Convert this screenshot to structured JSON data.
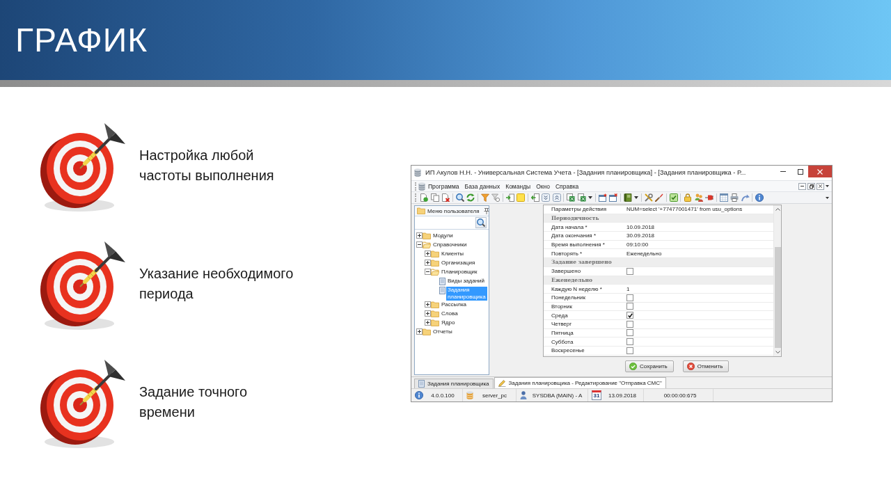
{
  "header": {
    "title": "ГРАФИК"
  },
  "features": [
    {
      "text": "Настройка любой\nчастоты выполнения"
    },
    {
      "text": "Указание необходимого\nпериода"
    },
    {
      "text": "Задание точного\nвремени"
    }
  ],
  "window": {
    "title": "ИП Акулов Н.Н. - Универсальная Система Учета - [Задания планировщика] - [Задания планировщика - Р..."
  },
  "menu": [
    "Программа",
    "База данных",
    "Команды",
    "Окно",
    "Справка"
  ],
  "sidebar": {
    "title": "Меню пользователя",
    "tree": [
      {
        "label": "Модули",
        "kind": "folder",
        "expanded": false,
        "selected": false
      },
      {
        "label": "Справочники",
        "kind": "folder",
        "expanded": true,
        "selected": false,
        "children": [
          {
            "label": "Клиенты",
            "kind": "folder",
            "expanded": false,
            "selected": false
          },
          {
            "label": "Организация",
            "kind": "folder",
            "expanded": false,
            "selected": false
          },
          {
            "label": "Планировщик",
            "kind": "folder",
            "expanded": true,
            "selected": false,
            "children": [
              {
                "label": "Виды заданий",
                "kind": "document",
                "selected": false
              },
              {
                "label": "Задания планировщика",
                "kind": "document",
                "selected": true
              }
            ]
          },
          {
            "label": "Рассылка",
            "kind": "folder",
            "expanded": false,
            "selected": false
          },
          {
            "label": "Слова",
            "kind": "folder",
            "expanded": false,
            "selected": false
          },
          {
            "label": "Ядро",
            "kind": "folder",
            "expanded": false,
            "selected": false
          }
        ]
      },
      {
        "label": "Отчеты",
        "kind": "folder",
        "expanded": false,
        "selected": false
      }
    ]
  },
  "form": {
    "rows": [
      {
        "kind": "text",
        "label": "Параметры действия",
        "value": "NUM=select '+77477001471' from usu_options"
      },
      {
        "kind": "section",
        "label": "Периодичность"
      },
      {
        "kind": "text",
        "label": "Дата начала *",
        "value": "10.09.2018"
      },
      {
        "kind": "text",
        "label": "Дата окончания *",
        "value": "30.09.2018"
      },
      {
        "kind": "text",
        "label": "Время выполнения *",
        "value": "09:10:00"
      },
      {
        "kind": "text",
        "label": "Повторять *",
        "value": "Еженедельно"
      },
      {
        "kind": "section",
        "label": "Задание завершено"
      },
      {
        "kind": "checkbox",
        "label": "Завершено",
        "checked": false
      },
      {
        "kind": "section",
        "label": "Еженедельно"
      },
      {
        "kind": "text",
        "label": "Каждую N неделю *",
        "value": "1"
      },
      {
        "kind": "checkbox",
        "label": "Понедельник",
        "checked": false
      },
      {
        "kind": "checkbox",
        "label": "Вторник",
        "checked": false
      },
      {
        "kind": "checkbox",
        "label": "Среда",
        "checked": true
      },
      {
        "kind": "checkbox",
        "label": "Четверг",
        "checked": false
      },
      {
        "kind": "checkbox",
        "label": "Пятница",
        "checked": false
      },
      {
        "kind": "checkbox",
        "label": "Суббота",
        "checked": false
      },
      {
        "kind": "checkbox",
        "label": "Воскресенье",
        "checked": false
      }
    ]
  },
  "buttons": [
    {
      "kind": "save",
      "label": "Сохранить"
    },
    {
      "kind": "cancel",
      "label": "Отменить"
    }
  ],
  "tabs": [
    {
      "label": "Задания планировщика",
      "kind": "list",
      "selected": false
    },
    {
      "label": "Задания планировщика - Редактирование \"Отправка СМС\"",
      "kind": "edit",
      "selected": true
    }
  ],
  "status_bar": [
    {
      "kind": "version",
      "text": "4.0.0.100"
    },
    {
      "kind": "server",
      "text": "server_pc"
    },
    {
      "kind": "user",
      "text": "SYSDBA (MAIN) - A"
    },
    {
      "kind": "date",
      "icon_text": "31",
      "text": "13.09.2018"
    },
    {
      "kind": "time",
      "text": "00:00:00:675"
    }
  ]
}
